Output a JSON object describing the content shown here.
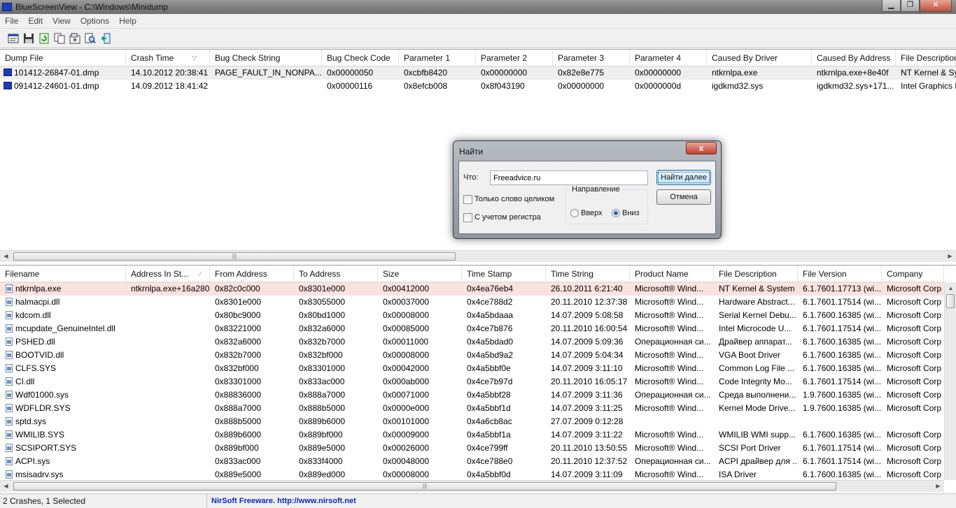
{
  "window": {
    "title": "BlueScreenView  -  C:\\Windows\\Minidump"
  },
  "menu": [
    "File",
    "Edit",
    "View",
    "Options",
    "Help"
  ],
  "toolbar": {
    "icons": [
      "properties-icon",
      "save-icon",
      "refresh-icon",
      "copy-icon",
      "options-icon",
      "find-icon",
      "exit-icon"
    ]
  },
  "top_list": {
    "columns": [
      "Dump File",
      "Crash Time",
      "Bug Check String",
      "Bug Check Code",
      "Parameter 1",
      "Parameter 2",
      "Parameter 3",
      "Parameter 4",
      "Caused By Driver",
      "Caused By Address",
      "File Description"
    ],
    "rows": [
      [
        "101412-26847-01.dmp",
        "14.10.2012 20:38:41",
        "PAGE_FAULT_IN_NONPA...",
        "0x00000050",
        "0xcbfb8420",
        "0x00000000",
        "0x82e8e775",
        "0x00000000",
        "ntkrnlpa.exe",
        "ntkrnlpa.exe+8e40f",
        "NT Kernel & Sy"
      ],
      [
        "091412-24601-01.dmp",
        "14.09.2012 18:41:42",
        "",
        "0x00000116",
        "0x8efcb008",
        "0x8f043190",
        "0x00000000",
        "0x0000000d",
        "igdkmd32.sys",
        "igdkmd32.sys+171...",
        "Intel Graphics K"
      ]
    ]
  },
  "bottom_list": {
    "columns": [
      "Filename",
      "Address In St...",
      "From Address",
      "To Address",
      "Size",
      "Time Stamp",
      "Time String",
      "Product Name",
      "File Description",
      "File Version",
      "Company"
    ],
    "rows": [
      [
        "ntkrnlpa.exe",
        "ntkrnlpa.exe+16a280",
        "0x82c0c000",
        "0x8301e000",
        "0x00412000",
        "0x4ea76eb4",
        "26.10.2011 6:21:40",
        "Microsoft® Wind...",
        "NT Kernel & System",
        "6.1.7601.17713 (wi...",
        "Microsoft Corp"
      ],
      [
        "halmacpi.dll",
        "",
        "0x8301e000",
        "0x83055000",
        "0x00037000",
        "0x4ce788d2",
        "20.11.2010 12:37:38",
        "Microsoft® Wind...",
        "Hardware Abstract...",
        "6.1.7601.17514 (wi...",
        "Microsoft Corp"
      ],
      [
        "kdcom.dll",
        "",
        "0x80bc9000",
        "0x80bd1000",
        "0x00008000",
        "0x4a5bdaaa",
        "14.07.2009 5:08:58",
        "Microsoft® Wind...",
        "Serial Kernel Debu...",
        "6.1.7600.16385 (wi...",
        "Microsoft Corp"
      ],
      [
        "mcupdate_GenuineIntel.dll",
        "",
        "0x83221000",
        "0x832a6000",
        "0x00085000",
        "0x4ce7b876",
        "20.11.2010 16:00:54",
        "Microsoft® Wind...",
        "Intel Microcode U...",
        "6.1.7601.17514 (wi...",
        "Microsoft Corp"
      ],
      [
        "PSHED.dll",
        "",
        "0x832a6000",
        "0x832b7000",
        "0x00011000",
        "0x4a5bdad0",
        "14.07.2009 5:09:36",
        "Операционная си...",
        "Драйвер аппарат...",
        "6.1.7600.16385 (wi...",
        "Microsoft Corp"
      ],
      [
        "BOOTVID.dll",
        "",
        "0x832b7000",
        "0x832bf000",
        "0x00008000",
        "0x4a5bd9a2",
        "14.07.2009 5:04:34",
        "Microsoft® Wind...",
        "VGA Boot Driver",
        "6.1.7600.16385 (wi...",
        "Microsoft Corp"
      ],
      [
        "CLFS.SYS",
        "",
        "0x832bf000",
        "0x83301000",
        "0x00042000",
        "0x4a5bbf0e",
        "14.07.2009 3:11:10",
        "Microsoft® Wind...",
        "Common Log File ...",
        "6.1.7600.16385 (wi...",
        "Microsoft Corp"
      ],
      [
        "CI.dll",
        "",
        "0x83301000",
        "0x833ac000",
        "0x000ab000",
        "0x4ce7b97d",
        "20.11.2010 16:05:17",
        "Microsoft® Wind...",
        "Code Integrity Mo...",
        "6.1.7601.17514 (wi...",
        "Microsoft Corp"
      ],
      [
        "Wdf01000.sys",
        "",
        "0x88836000",
        "0x888a7000",
        "0x00071000",
        "0x4a5bbf28",
        "14.07.2009 3:11:36",
        "Операционная си...",
        "Среда выполнени...",
        "1.9.7600.16385 (wi...",
        "Microsoft Corp"
      ],
      [
        "WDFLDR.SYS",
        "",
        "0x888a7000",
        "0x888b5000",
        "0x0000e000",
        "0x4a5bbf1d",
        "14.07.2009 3:11:25",
        "Microsoft® Wind...",
        "Kernel Mode Drive...",
        "1.9.7600.16385 (wi...",
        "Microsoft Corp"
      ],
      [
        "sptd.sys",
        "",
        "0x888b5000",
        "0x889b6000",
        "0x00101000",
        "0x4a6cb8ac",
        "27.07.2009 0:12:28",
        "",
        "",
        "",
        ""
      ],
      [
        "WMILIB.SYS",
        "",
        "0x889b6000",
        "0x889bf000",
        "0x00009000",
        "0x4a5bbf1a",
        "14.07.2009 3:11:22",
        "Microsoft® Wind...",
        "WMILIB WMI supp...",
        "6.1.7600.16385 (wi...",
        "Microsoft Corp"
      ],
      [
        "SCSIPORT.SYS",
        "",
        "0x889bf000",
        "0x889e5000",
        "0x00026000",
        "0x4ce799ff",
        "20.11.2010 13:50:55",
        "Microsoft® Wind...",
        "SCSI Port Driver",
        "6.1.7601.17514 (wi...",
        "Microsoft Corp"
      ],
      [
        "ACPI.sys",
        "",
        "0x833ac000",
        "0x833f4000",
        "0x00048000",
        "0x4ce788e0",
        "20.11.2010 12:37:52",
        "Операционная си...",
        "ACPI драйвер для ...",
        "6.1.7601.17514 (wi...",
        "Microsoft Corp"
      ],
      [
        "msisadrv.sys",
        "",
        "0x889e5000",
        "0x889ed000",
        "0x00008000",
        "0x4a5bbf0d",
        "14.07.2009 3:11:09",
        "Microsoft® Wind...",
        "ISA Driver",
        "6.1.7600.16385 (wi...",
        "Microsoft Corp"
      ]
    ]
  },
  "status": {
    "summary": "2 Crashes, 1 Selected",
    "link": "NirSoft Freeware.  http://www.nirsoft.net"
  },
  "find_dialog": {
    "title": "Найти",
    "close_label": "x",
    "what_label": "Что:",
    "what_value": "Freeadvice.ru",
    "find_next_label": "Найти далее",
    "cancel_label": "Отмена",
    "whole_word_label": "Только слово целиком",
    "match_case_label": "С учетом регистра",
    "direction_label": "Направление",
    "up_label": "Вверх",
    "down_label": "Вниз",
    "direction_selected": "down"
  },
  "colors": {
    "selected_row": "#fbe1e1",
    "link": "#0b27c2",
    "dump_icon": "#1e3bb6"
  }
}
